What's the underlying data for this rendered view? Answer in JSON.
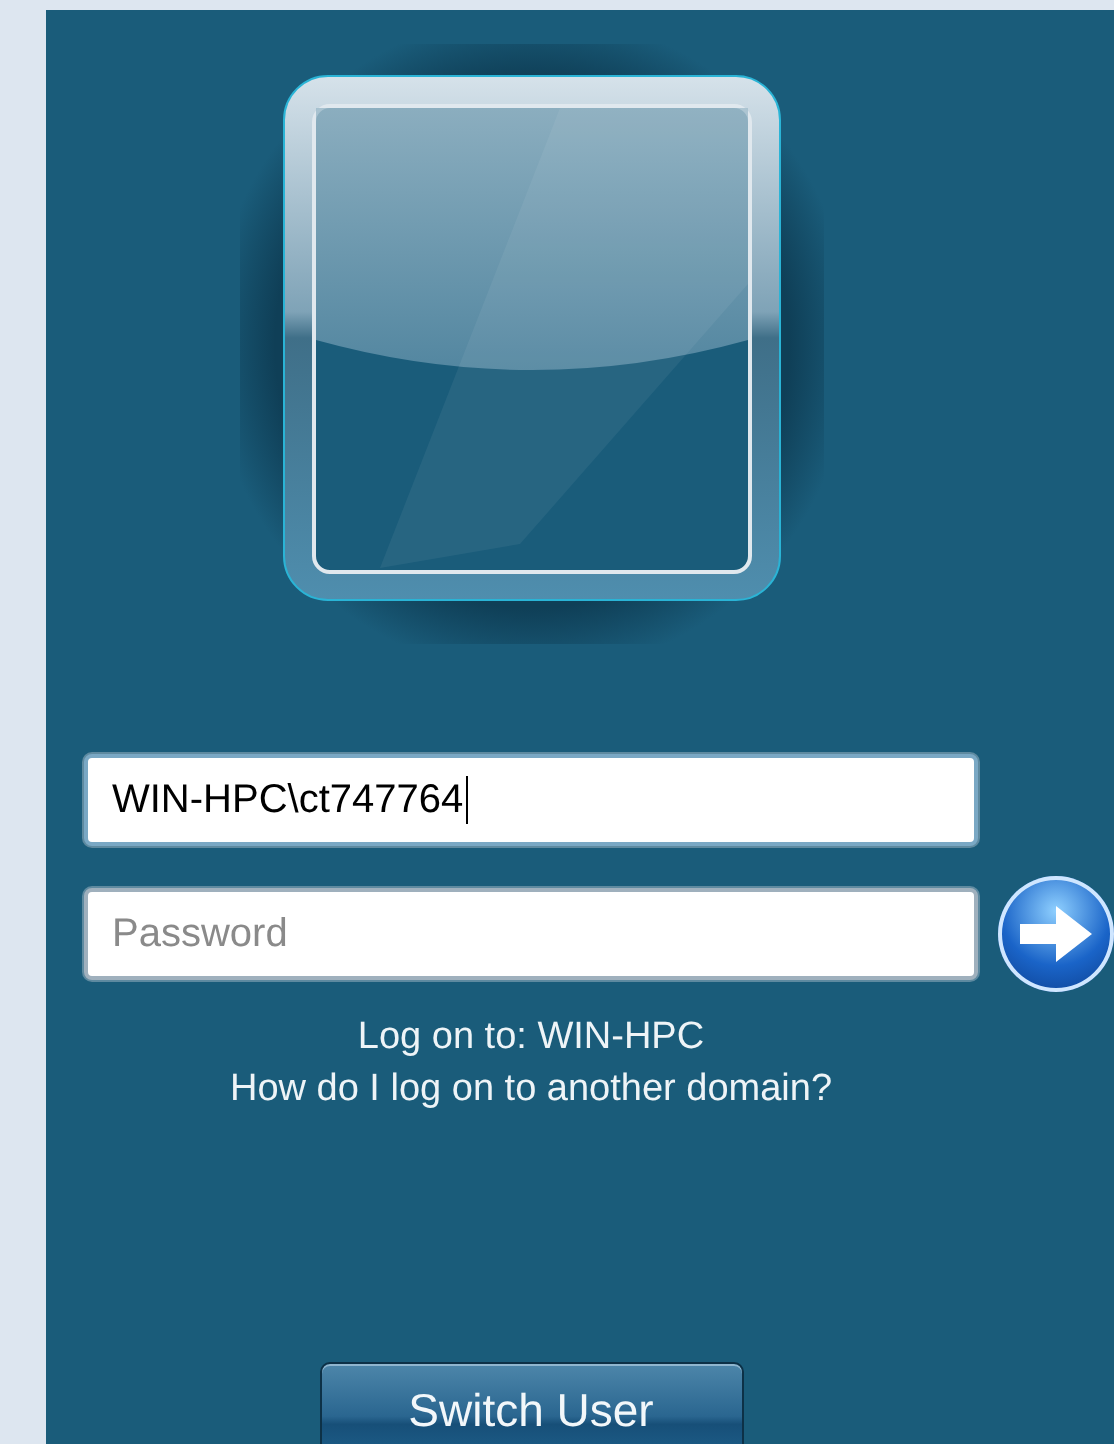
{
  "username": {
    "value": "WIN-HPC\\ct747764",
    "focused": true
  },
  "password": {
    "placeholder": "Password"
  },
  "log_on_to": "Log on to: WIN-HPC",
  "help_link": "How do I log on to another domain?",
  "switch_user_button": "Switch User"
}
